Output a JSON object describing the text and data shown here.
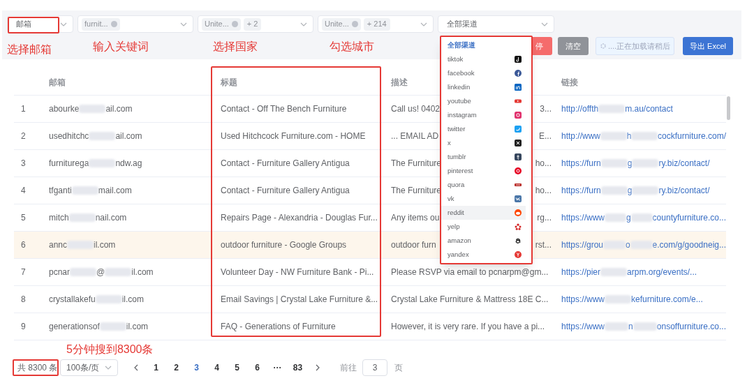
{
  "filters": [
    {
      "kind": "select",
      "value": "邮箱"
    },
    {
      "kind": "tags",
      "tags": [
        "furnit..."
      ]
    },
    {
      "kind": "tags",
      "tags": [
        "Unite..."
      ],
      "more": "+ 2"
    },
    {
      "kind": "tags",
      "tags": [
        "Unite..."
      ],
      "more": "+ 214"
    },
    {
      "kind": "select",
      "value": "全部渠道"
    }
  ],
  "buttons": [
    {
      "kind": "danger",
      "label": "停"
    },
    {
      "kind": "neutral",
      "label": "清空"
    },
    {
      "kind": "loading",
      "label": "....正在加载请稍后"
    },
    {
      "kind": "primary",
      "label": "导出 Excel"
    }
  ],
  "channel_menu": [
    {
      "label": "全部渠道",
      "selected": true,
      "hovered": false
    },
    {
      "label": "tiktok",
      "selected": false,
      "hovered": false
    },
    {
      "label": "facebook",
      "selected": false,
      "hovered": false
    },
    {
      "label": "linkedin",
      "selected": false,
      "hovered": false
    },
    {
      "label": "youtube",
      "selected": false,
      "hovered": false
    },
    {
      "label": "instagram",
      "selected": false,
      "hovered": false
    },
    {
      "label": "twitter",
      "selected": false,
      "hovered": false
    },
    {
      "label": "x",
      "selected": false,
      "hovered": false
    },
    {
      "label": "tumblr",
      "selected": false,
      "hovered": false
    },
    {
      "label": "pinterest",
      "selected": false,
      "hovered": false
    },
    {
      "label": "quora",
      "selected": false,
      "hovered": false
    },
    {
      "label": "vk",
      "selected": false,
      "hovered": false
    },
    {
      "label": "reddit",
      "selected": false,
      "hovered": true
    },
    {
      "label": "yelp",
      "selected": false,
      "hovered": false
    },
    {
      "label": "amazon",
      "selected": false,
      "hovered": false
    },
    {
      "label": "yandex",
      "selected": false,
      "hovered": false
    }
  ],
  "table": {
    "columns": [
      "邮箱",
      "标题",
      "描述",
      "链接"
    ],
    "rows": [
      {
        "index": "1",
        "email": [
          "abourke",
          "ail.com"
        ],
        "title": "Contact - Off The Bench Furniture",
        "description": [
          "Call us! 0402",
          "3..."
        ],
        "link": [
          "http://offth",
          "m.au/contact"
        ],
        "highlighted": false
      },
      {
        "index": "2",
        "email": [
          "usedhitchc",
          "ail.com"
        ],
        "title": "Used Hitchcock Furniture.com - HOME",
        "description": [
          "... EMAIL AD",
          "E..."
        ],
        "link": [
          "http://www",
          "h",
          "cockfurniture.com/"
        ],
        "highlighted": false
      },
      {
        "index": "3",
        "email": [
          "furniturega",
          "ndw.ag"
        ],
        "title": "Contact - Furniture Gallery Antigua",
        "description": [
          "The Furniture",
          "ho..."
        ],
        "link": [
          "https://furn",
          "g",
          "ry.biz/contact/"
        ],
        "highlighted": false
      },
      {
        "index": "4",
        "email": [
          "tfganti",
          "mail.com"
        ],
        "title": "Contact - Furniture Gallery Antigua",
        "description": [
          "The Furniture",
          "ho..."
        ],
        "link": [
          "https://furn",
          "g",
          "ry.biz/contact/"
        ],
        "highlighted": false
      },
      {
        "index": "5",
        "email": [
          "mitch",
          "nail.com"
        ],
        "title": "Repairs Page - Alexandria - Douglas Fur...",
        "description": [
          "Any items ou",
          "rg..."
        ],
        "link": [
          "https://www",
          "g",
          "countyfurniture.co..."
        ],
        "highlighted": false
      },
      {
        "index": "6",
        "email": [
          "annc",
          "il.com"
        ],
        "title": "outdoor furniture - Google Groups",
        "description": [
          "outdoor furn",
          "rst..."
        ],
        "link": [
          "https://grou",
          "o",
          "e.com/g/goodneig..."
        ],
        "highlighted": true
      },
      {
        "index": "7",
        "email": [
          "pcnar",
          "@",
          "il.com"
        ],
        "title": "Volunteer Day - NW Furniture Bank - Pi...",
        "description": [
          "Please RSVP via email to pcnarpm@gm..."
        ],
        "link": [
          "https://pier",
          "arpm.org/events/..."
        ],
        "highlighted": false
      },
      {
        "index": "8",
        "email": [
          "crystallakefu",
          "il.com"
        ],
        "title": "Email Savings | Crystal Lake Furniture &...",
        "description": [
          "Crystal Lake Furniture & Mattress 18E C..."
        ],
        "link": [
          "https://www",
          "kefurniture.com/e..."
        ],
        "highlighted": false
      },
      {
        "index": "9",
        "email": [
          "generationsof",
          "il.com"
        ],
        "title": "FAQ - Generations of Furniture",
        "description": [
          "However, it is very rare. If you have a pi..."
        ],
        "link": [
          "https://www",
          "n",
          "onsoffurniture.co..."
        ],
        "highlighted": false
      }
    ]
  },
  "pagination": {
    "total": "共 8300 条",
    "page_size": "100条/页",
    "pages": [
      {
        "label": "1",
        "selected": false
      },
      {
        "label": "2",
        "selected": false
      },
      {
        "label": "3",
        "selected": true
      },
      {
        "label": "4",
        "selected": false
      },
      {
        "label": "5",
        "selected": false
      },
      {
        "label": "6",
        "selected": false
      },
      {
        "label": "···",
        "selected": false
      },
      {
        "label": "83",
        "selected": false
      }
    ],
    "goto_label": "前往",
    "goto_value": "3",
    "goto_suffix": "页"
  },
  "annotations": [
    "选择邮箱",
    "输入关键词",
    "选择国家",
    "勾选城市",
    "5分钟搜到8300条"
  ]
}
